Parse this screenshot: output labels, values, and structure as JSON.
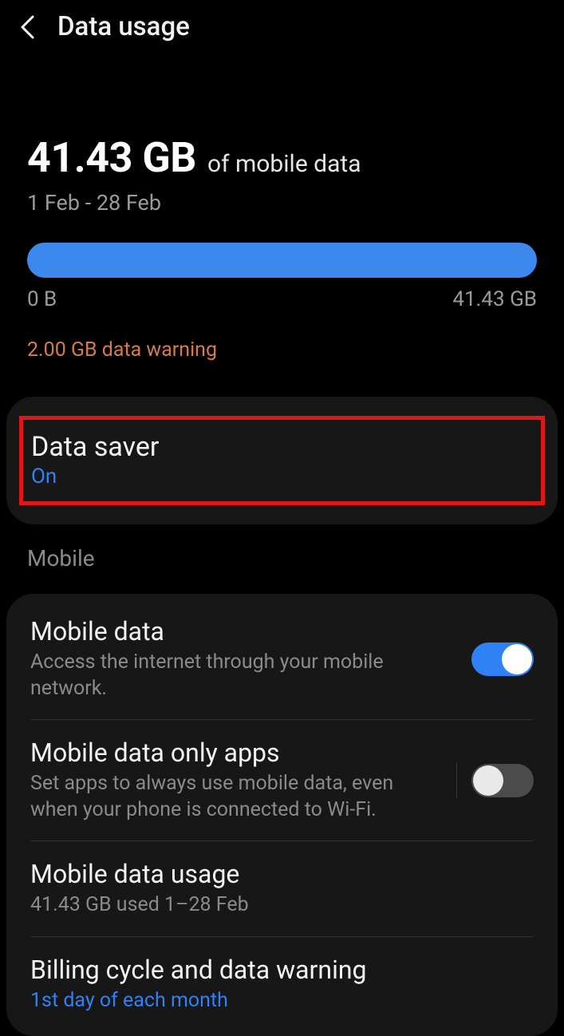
{
  "header": {
    "title": "Data usage"
  },
  "summary": {
    "amount": "41.43 GB",
    "suffix": "of mobile data",
    "period": "1 Feb - 28 Feb",
    "progress_min": "0 B",
    "progress_max": "41.43 GB",
    "warning": "2.00 GB data warning"
  },
  "data_saver": {
    "title": "Data saver",
    "status": "On"
  },
  "section_mobile": {
    "label": "Mobile"
  },
  "mobile_data": {
    "title": "Mobile data",
    "desc": "Access the internet through your mobile network.",
    "toggle": true
  },
  "mobile_only_apps": {
    "title": "Mobile data only apps",
    "desc": "Set apps to always use mobile data, even when your phone is connected to Wi-Fi.",
    "toggle": false
  },
  "mobile_usage": {
    "title": "Mobile data usage",
    "desc": "41.43 GB used 1–28 Feb"
  },
  "billing": {
    "title": "Billing cycle and data warning",
    "desc": "1st day of each month"
  }
}
